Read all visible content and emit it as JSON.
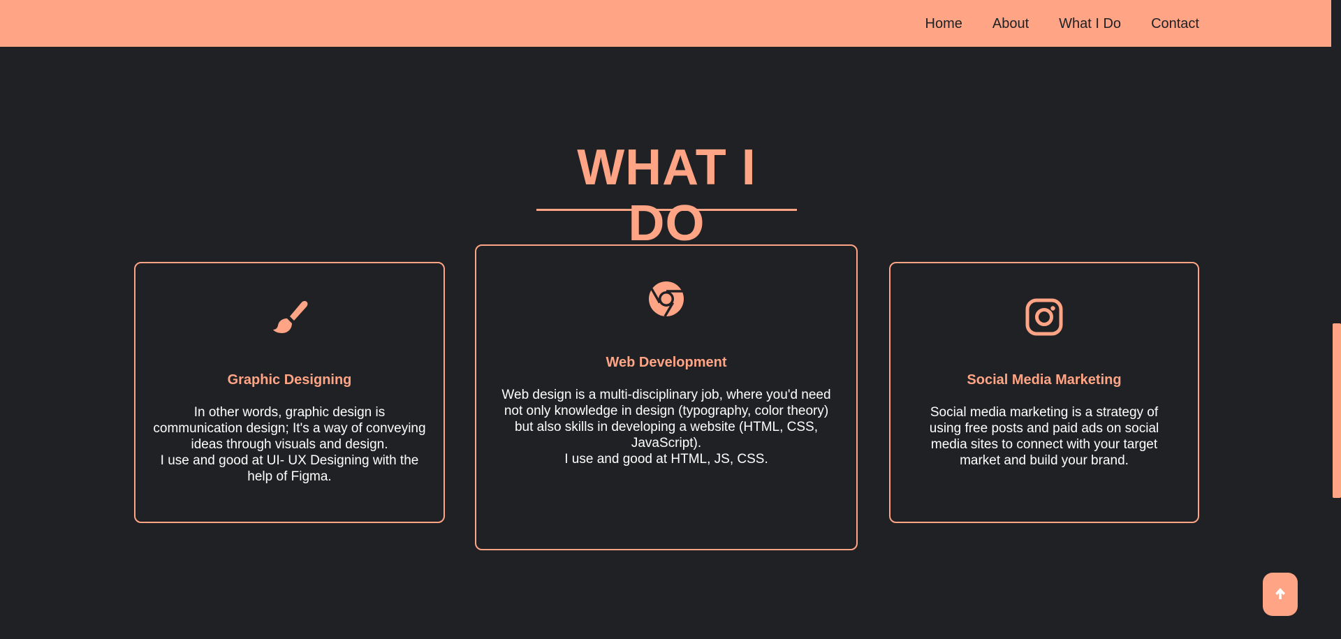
{
  "nav": {
    "items": [
      {
        "label": "Home"
      },
      {
        "label": "About"
      },
      {
        "label": "What I Do"
      },
      {
        "label": "Contact"
      }
    ]
  },
  "section": {
    "title": "WHAT I DO"
  },
  "cards": [
    {
      "icon": "paintbrush-icon",
      "title": "Graphic Designing",
      "description": "In other words, graphic design is communication design; It's a way of conveying ideas through visuals and design.",
      "extra": "I use and good at UI- UX Designing with the help of Figma."
    },
    {
      "icon": "chrome-icon",
      "title": "Web Development",
      "description": "Web design is a multi-disciplinary job, where you'd need not only knowledge in design (typography, color theory) but also skills in developing a website (HTML, CSS, JavaScript).",
      "extra": "I use and good at HTML, JS, CSS."
    },
    {
      "icon": "instagram-icon",
      "title": "Social Media Marketing",
      "description": "Social media marketing is a strategy of using free posts and paid ads on social media sites to connect with your target market and build your brand.",
      "extra": ""
    }
  ],
  "colors": {
    "accent": "#ffa485",
    "background": "#202124",
    "text": "#ffffff"
  },
  "back_to_top": {
    "icon": "arrow-up-icon"
  }
}
